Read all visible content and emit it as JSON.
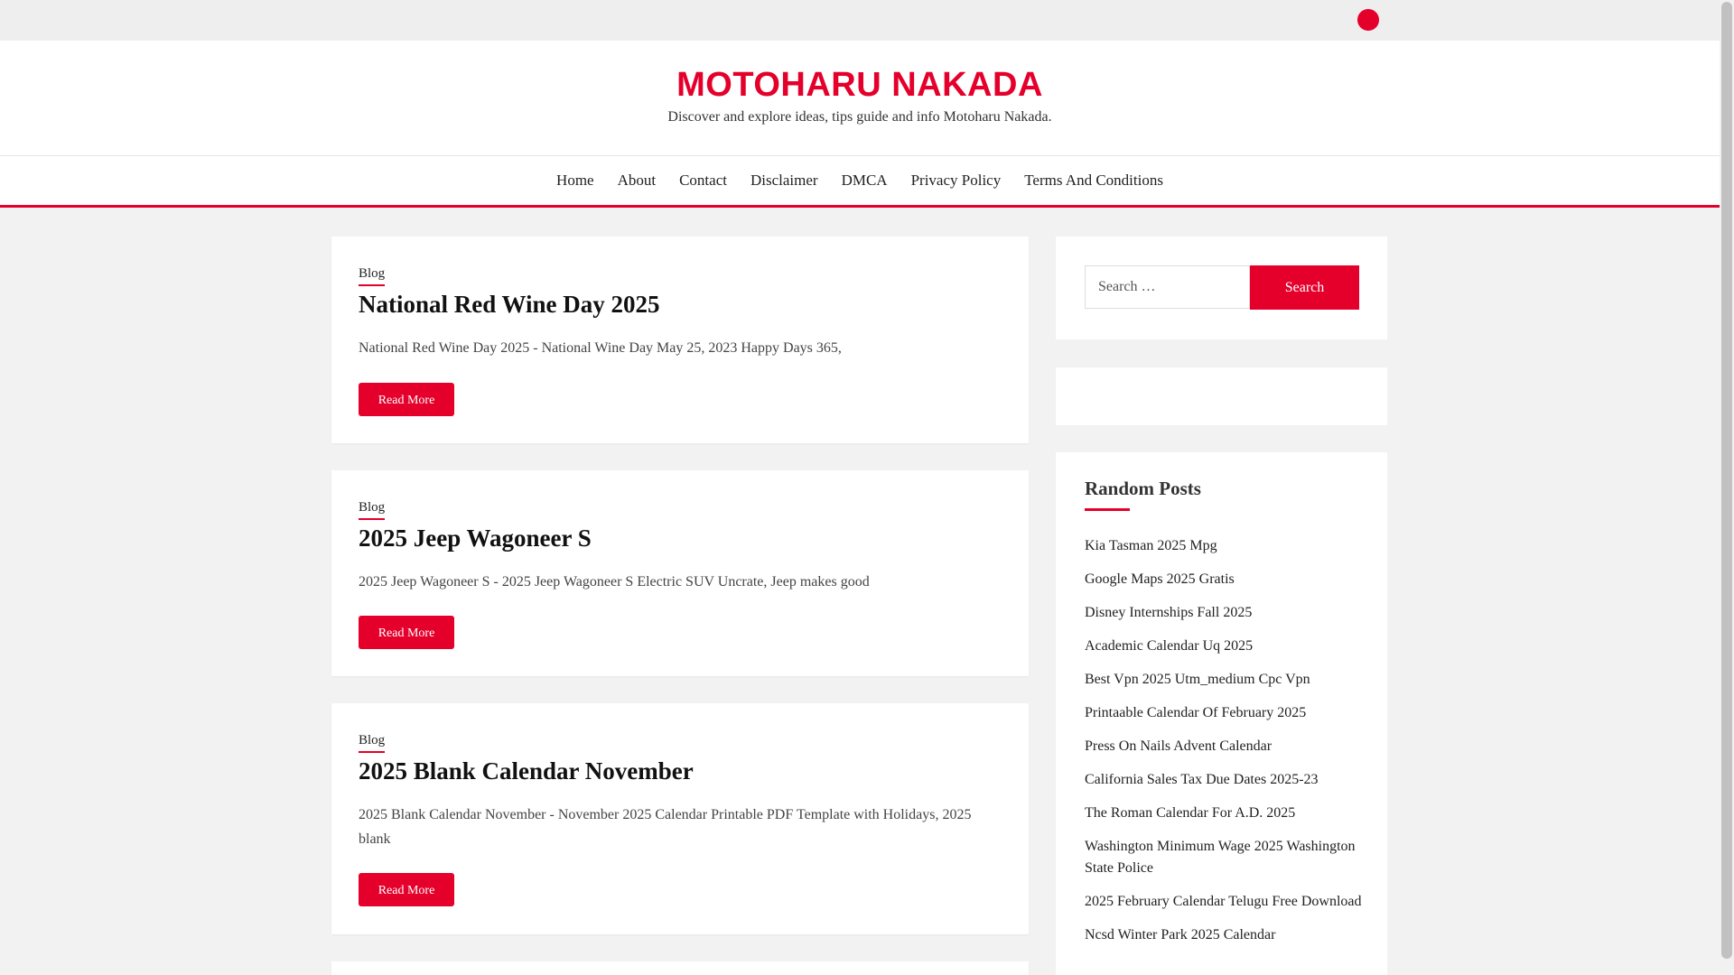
{
  "header": {
    "site_title": "MOTOHARU NAKADA",
    "tagline": "Discover and explore ideas, tips guide and info Motoharu Nakada."
  },
  "nav": {
    "items": [
      "Home",
      "About",
      "Contact",
      "Disclaimer",
      "DMCA",
      "Privacy Policy",
      "Terms And Conditions"
    ]
  },
  "posts": [
    {
      "category": "Blog",
      "title": "National Red Wine Day 2025",
      "excerpt": "National Red Wine Day 2025 - National Wine Day May 25, 2023 Happy Days 365,",
      "button": "Read More"
    },
    {
      "category": "Blog",
      "title": "2025 Jeep Wagoneer S",
      "excerpt": "2025 Jeep Wagoneer S - 2025 Jeep Wagoneer S Electric SUV Uncrate, Jeep makes good",
      "button": "Read More"
    },
    {
      "category": "Blog",
      "title": "2025 Blank Calendar November",
      "excerpt": "2025 Blank Calendar November - November 2025 Calendar Printable PDF Template with Holidays, 2025 blank",
      "button": "Read More"
    }
  ],
  "sidebar": {
    "search": {
      "placeholder": "Search …",
      "button": "Search"
    },
    "random_posts": {
      "title": "Random Posts",
      "items": [
        "Kia Tasman 2025 Mpg",
        "Google Maps 2025 Gratis",
        "Disney Internships Fall 2025",
        "Academic Calendar Uq 2025",
        "Best Vpn 2025 Utm_medium Cpc Vpn",
        "Printaable Calendar Of February 2025",
        "Press On Nails Advent Calendar",
        "California Sales Tax Due Dates 2025-23",
        "The Roman Calendar For A.D. 2025",
        "Washington Minimum Wage 2025 Washington State Police",
        "2025 February Calendar Telugu Free Download",
        "Ncsd Winter Park 2025 Calendar"
      ]
    }
  },
  "colors": {
    "accent": "#e4002b",
    "background": "#f2f2f2",
    "card": "#ffffff"
  }
}
